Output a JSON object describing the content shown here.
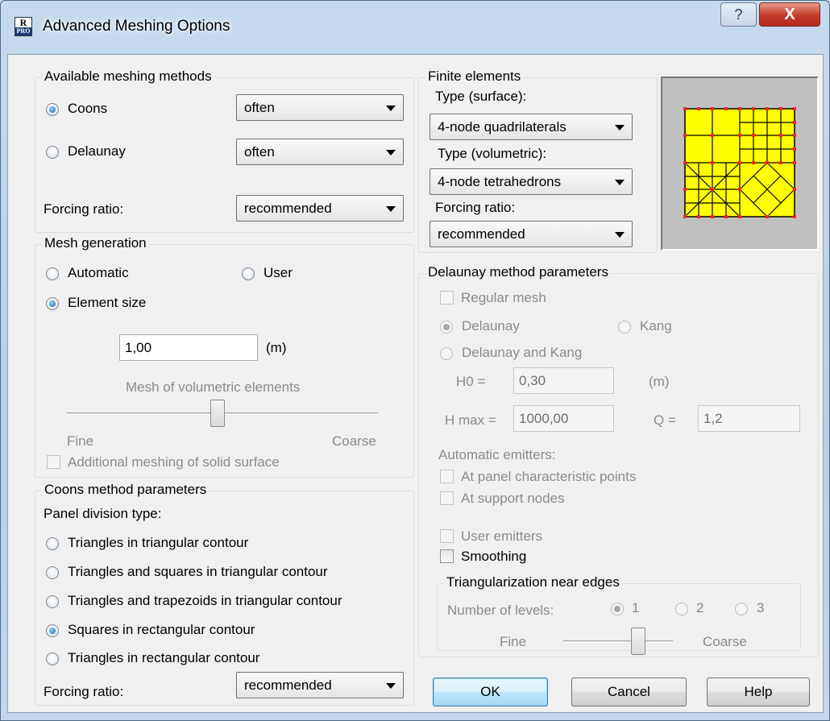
{
  "window": {
    "title": "Advanced Meshing Options",
    "help_glyph": "?",
    "close_glyph": "X",
    "icon_top": "R",
    "icon_bottom": "PRO"
  },
  "meshing_methods": {
    "legend": "Available meshing methods",
    "coons": {
      "label": "Coons",
      "combo": "often"
    },
    "delaunay": {
      "label": "Delaunay",
      "combo": "often"
    },
    "forcing": {
      "label": "Forcing ratio:",
      "combo": "recommended"
    }
  },
  "finite_elements": {
    "legend": "Finite elements",
    "surface_label": "Type (surface):",
    "surface_value": "4-node quadrilaterals",
    "volumetric_label": "Type (volumetric):",
    "volumetric_value": "4-node tetrahedrons",
    "forcing_label": "Forcing ratio:",
    "forcing_value": "recommended"
  },
  "mesh_generation": {
    "legend": "Mesh generation",
    "automatic": "Automatic",
    "user": "User",
    "element_size": "Element size",
    "size_value": "1,00",
    "size_unit": "(m)",
    "volumetric_caption": "Mesh of volumetric elements",
    "fine": "Fine",
    "coarse": "Coarse",
    "additional": "Additional meshing of solid surface"
  },
  "delaunay_params": {
    "legend": "Delaunay method parameters",
    "regular_mesh": "Regular mesh",
    "delaunay": "Delaunay",
    "kang": "Kang",
    "delaunay_kang": "Delaunay and Kang",
    "h0_label": "H0 =",
    "h0_value": "0,30",
    "h0_unit": "(m)",
    "hmax_label": "H max =",
    "hmax_value": "1000,00",
    "q_label": "Q =",
    "q_value": "1,2",
    "emitters_label": "Automatic emitters:",
    "panel_points": "At panel characteristic points",
    "support_nodes": "At support nodes",
    "user_emitters": "User emitters",
    "smoothing": "Smoothing"
  },
  "triangularization": {
    "legend": "Triangularization near edges",
    "levels_label": "Number of levels:",
    "level1": "1",
    "level2": "2",
    "level3": "3",
    "fine": "Fine",
    "coarse": "Coarse"
  },
  "coons_params": {
    "legend": "Coons method parameters",
    "division_label": "Panel division type:",
    "opt1": "Triangles in triangular contour",
    "opt2": "Triangles and squares in triangular contour",
    "opt3": "Triangles and trapezoids in triangular contour",
    "opt4": "Squares in rectangular contour",
    "opt5": "Triangles in rectangular contour",
    "forcing_label": "Forcing ratio:",
    "forcing_value": "recommended"
  },
  "buttons": {
    "ok": "OK",
    "cancel": "Cancel",
    "help": "Help"
  },
  "colors": {
    "preview_fill": "#ffff00",
    "preview_nodes": "#ff2020",
    "preview_bg": "#c0c0c0"
  }
}
